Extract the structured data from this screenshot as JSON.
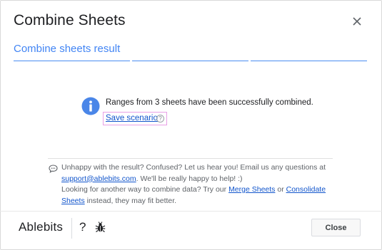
{
  "dialog": {
    "title": "Combine Sheets",
    "close_icon": "close-x-icon"
  },
  "step": {
    "title": "Combine sheets result",
    "segments_total": 3,
    "accent_color": "#4285f4"
  },
  "result": {
    "icon": "info-icon",
    "message": "Ranges from 3 sheets have been successfully combined.",
    "save_scenario_label": "Save scenario",
    "help_glyph": "?"
  },
  "feedback": {
    "icon": "chat-bubble-icon",
    "line1_text": "Unhappy with the result? Confused? Let us hear you! Email us any questions at ",
    "email_link": "support@ablebits.com",
    "line1_tail": ". We'll be really happy to help! :)",
    "line2_text": "Looking for another way to combine data? Try our ",
    "merge_link": "Merge Sheets",
    "or_text": " or ",
    "consolidate_link": "Consolidate Sheets",
    "line2_tail": " instead, they may fit better."
  },
  "footer": {
    "brand": "Ablebits",
    "help_glyph": "?",
    "bug_icon": "bug-icon",
    "close_label": "Close"
  }
}
